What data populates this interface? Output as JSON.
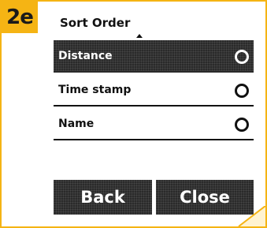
{
  "step": {
    "badge": "2e"
  },
  "screen": {
    "title": "Sort Order",
    "scroll_up_icon": "triangle-up"
  },
  "options": [
    {
      "label": "Distance",
      "selected": true,
      "icon": "radio-circle"
    },
    {
      "label": "Time stamp",
      "selected": false,
      "icon": "radio-circle"
    },
    {
      "label": "Name",
      "selected": false,
      "icon": "radio-circle"
    }
  ],
  "buttons": {
    "back": "Back",
    "close": "Close"
  },
  "colors": {
    "accent": "#f5b414",
    "selected_bg": "#2a2a2a",
    "text": "#111111"
  }
}
